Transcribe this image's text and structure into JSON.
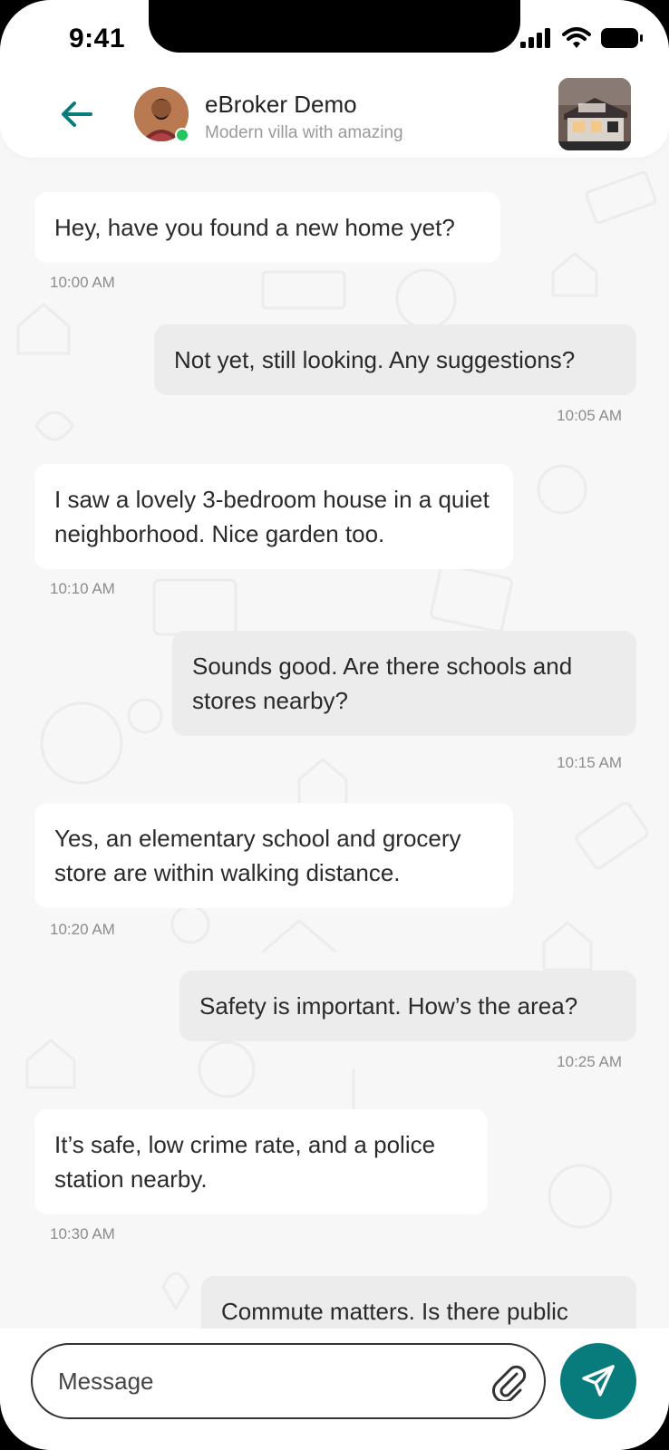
{
  "status_bar": {
    "time": "9:41"
  },
  "header": {
    "contact_name": "eBroker Demo",
    "property_subtitle": "Modern villa with amazing",
    "online": true
  },
  "colors": {
    "accent": "#087c7c",
    "online": "#22c55e",
    "incoming_bubble": "#ffffff",
    "outgoing_bubble": "#ececec"
  },
  "messages": [
    {
      "direction": "in",
      "text": "Hey, have you found a new home yet?",
      "time": "10:00 AM"
    },
    {
      "direction": "out",
      "text": "Not yet, still looking. Any suggestions?",
      "time": "10:05 AM"
    },
    {
      "direction": "in",
      "text": "I saw a lovely 3-bedroom house in a quiet neighborhood. Nice garden too.",
      "time": "10:10 AM"
    },
    {
      "direction": "out",
      "text": "Sounds good. Are there schools and stores nearby?",
      "time": "10:15 AM"
    },
    {
      "direction": "in",
      "text": "Yes, an elementary school and grocery store are within walking distance.",
      "time": "10:20 AM"
    },
    {
      "direction": "out",
      "text": "Safety is important. How’s the area?",
      "time": "10:25 AM"
    },
    {
      "direction": "in",
      "text": "It’s safe, low crime rate, and a police station nearby.",
      "time": "10:30 AM"
    },
    {
      "direction": "out",
      "text": "Commute matters. Is there public",
      "time": ""
    }
  ],
  "composer": {
    "placeholder": "Message"
  },
  "icons": {
    "back": "arrow-left-icon",
    "attach": "paperclip-icon",
    "send": "send-icon"
  }
}
